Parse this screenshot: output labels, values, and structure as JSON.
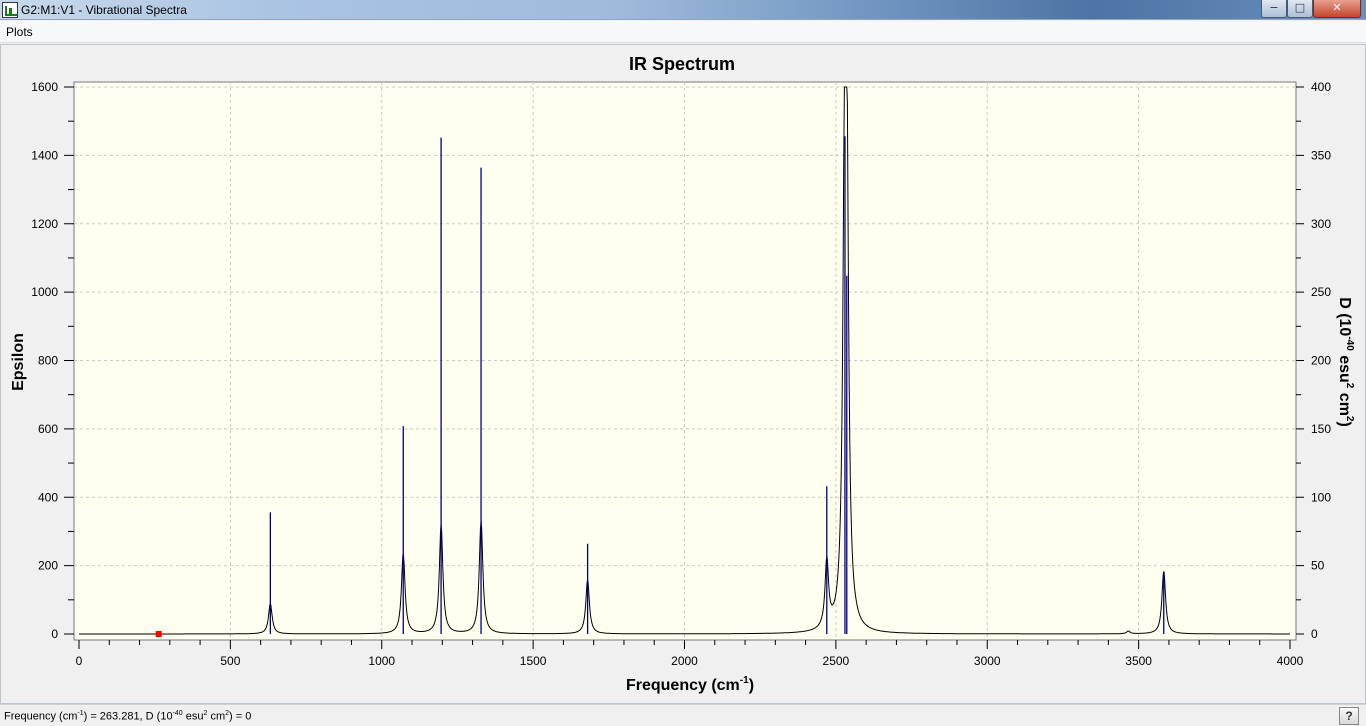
{
  "window": {
    "title": "G2:M1:V1 - Vibrational Spectra",
    "minimize_glyph": "−",
    "maximize_glyph": "□",
    "close_glyph": "✕"
  },
  "menu": {
    "items": [
      {
        "label": "Plots"
      }
    ]
  },
  "status": {
    "text_prefix": "Frequency (cm",
    "sup1": "-1",
    "text_mid": ") = 263.281, D (10",
    "sup2": "-40",
    "text_mid2": " esu",
    "sup3": "2",
    "text_mid3": " cm",
    "sup4": "2",
    "text_suffix": ") = 0",
    "help_label": "?"
  },
  "colors": {
    "plot_background": "#fffff0",
    "stick_color": "#00008b",
    "curve_color": "#000000",
    "cursor_marker": "#ff0000",
    "grid": "#c8c8c8"
  },
  "chart_data": {
    "type": "line",
    "title": "IR Spectrum",
    "xlabel": "Frequency (cm-1)",
    "xlabel_base": "Frequency (cm",
    "xlabel_sup": "-1",
    "xlabel_end": ")",
    "ylabel": "Epsilon",
    "y2label": "D (10-40 esu2 cm2)",
    "y2label_parts": [
      "D (10",
      "-40",
      " esu",
      "2",
      " cm",
      "2",
      ")"
    ],
    "xlim": [
      0,
      4000
    ],
    "ylim": [
      0,
      1600
    ],
    "y2lim": [
      0,
      400
    ],
    "xticks": [
      0,
      500,
      1000,
      1500,
      2000,
      2500,
      3000,
      3500,
      4000
    ],
    "yticks": [
      0,
      200,
      400,
      600,
      800,
      1000,
      1200,
      1400,
      1600
    ],
    "y2ticks": [
      0,
      50,
      100,
      150,
      200,
      250,
      300,
      350,
      400
    ],
    "grid": true,
    "cursor_x": 263.281,
    "sticks": [
      {
        "x": 632,
        "D": 89
      },
      {
        "x": 1071,
        "D": 152
      },
      {
        "x": 1196,
        "D": 363
      },
      {
        "x": 1328,
        "D": 341
      },
      {
        "x": 1680,
        "D": 66
      },
      {
        "x": 2470,
        "D": 108
      },
      {
        "x": 2530,
        "D": 364
      },
      {
        "x": 2536,
        "D": 262
      },
      {
        "x": 3583,
        "D": 44
      }
    ],
    "curve_peaks": [
      {
        "x": 632,
        "epsilon": 90
      },
      {
        "x": 1071,
        "epsilon": 235
      },
      {
        "x": 1196,
        "epsilon": 320
      },
      {
        "x": 1328,
        "epsilon": 330
      },
      {
        "x": 1680,
        "epsilon": 160
      },
      {
        "x": 2470,
        "epsilon": 200
      },
      {
        "x": 2530,
        "epsilon": 1360
      },
      {
        "x": 2536,
        "epsilon": 1040
      },
      {
        "x": 3466,
        "epsilon": 8
      },
      {
        "x": 3583,
        "epsilon": 185
      }
    ]
  }
}
